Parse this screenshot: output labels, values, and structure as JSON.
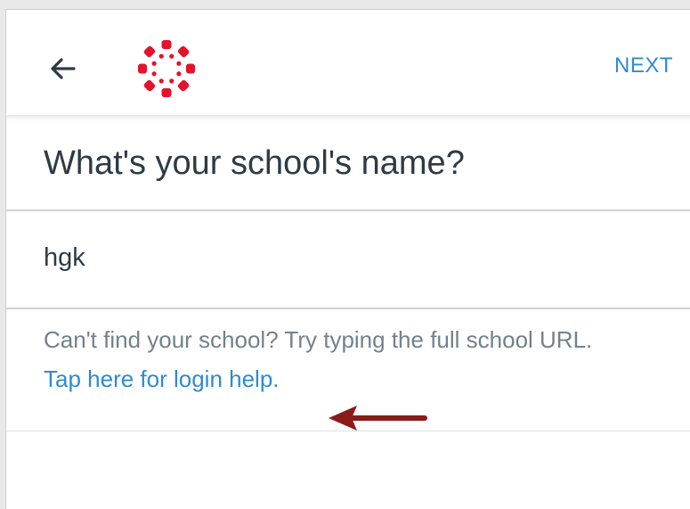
{
  "toolbar": {
    "back_icon": "arrow-left-icon",
    "logo_icon": "canvas-logo-icon",
    "next_label": "NEXT"
  },
  "colors": {
    "brand_red": "#e3132b",
    "link_blue": "#2f8bcf",
    "title_text": "#2d3b45",
    "helper_text": "#73818c",
    "annotation_arrow": "#8b1a1a"
  },
  "main": {
    "title": "What's your school's name?",
    "school_input": {
      "value": "hgk",
      "placeholder": ""
    },
    "helper_text": "Can't find your school? Try typing the full school URL.",
    "login_help_link": "Tap here for login help."
  },
  "annotation": {
    "icon": "annotation-arrow-icon"
  }
}
